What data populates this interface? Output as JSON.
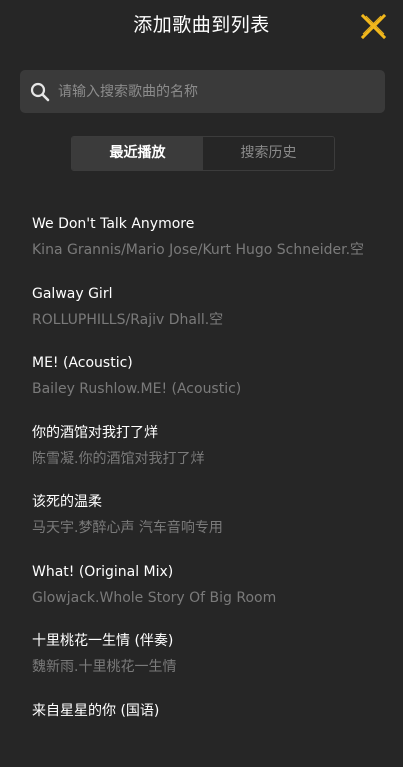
{
  "header": {
    "title": "添加歌曲到列表",
    "close_icon": "close-x-icon",
    "accent_color": "#f2b81c"
  },
  "search": {
    "placeholder": "请输入搜索歌曲的名称",
    "value": "",
    "icon": "search-icon"
  },
  "tabs": [
    {
      "label": "最近播放",
      "active": true
    },
    {
      "label": "搜索历史",
      "active": false
    }
  ],
  "songs": [
    {
      "title": "We Don't Talk Anymore",
      "artist": "Kina Grannis/Mario Jose/Kurt Hugo Schneider.空"
    },
    {
      "title": "Galway Girl",
      "artist": "ROLLUPHILLS/Rajiv Dhall.空"
    },
    {
      "title": "ME! (Acoustic)",
      "artist": "Bailey Rushlow.ME! (Acoustic)"
    },
    {
      "title": "你的酒馆对我打了烊",
      "artist": "陈雪凝.你的酒馆对我打了烊"
    },
    {
      "title": "该死的温柔",
      "artist": "马天宇.梦醉心声 汽车音响专用"
    },
    {
      "title": "What! (Original Mix)",
      "artist": "Glowjack.Whole Story Of Big Room"
    },
    {
      "title": "十里桃花一生情 (伴奏)",
      "artist": "魏新雨.十里桃花一生情"
    },
    {
      "title": "来自星星的你 (国语)",
      "artist": ""
    }
  ]
}
